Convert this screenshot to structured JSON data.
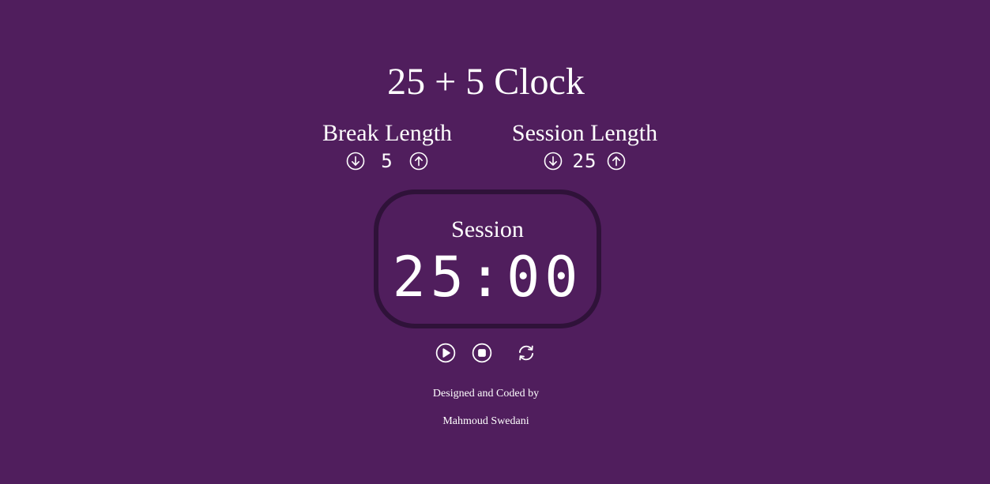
{
  "title": "25 + 5 Clock",
  "break": {
    "label": "Break Length",
    "value": "5",
    "decrement_icon": "arrow-down-circle-icon",
    "increment_icon": "arrow-up-circle-icon"
  },
  "session": {
    "label": "Session Length",
    "value": "25",
    "decrement_icon": "arrow-down-circle-icon",
    "increment_icon": "arrow-up-circle-icon"
  },
  "timer": {
    "label": "Session",
    "time_left": "25:00"
  },
  "controls": {
    "play_icon": "play-circle-icon",
    "stop_icon": "stop-circle-icon",
    "reset_icon": "refresh-icon"
  },
  "footer": {
    "line1": "Designed and Coded by",
    "line2": "Mahmoud Swedani"
  },
  "colors": {
    "background": "#501e5d",
    "clock_border": "#2f1239",
    "text": "#ffffff"
  }
}
